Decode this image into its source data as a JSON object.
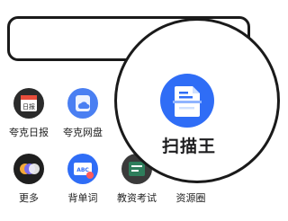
{
  "apps": [
    {
      "label": "夸克日报",
      "icon": "daily-news-icon"
    },
    {
      "label": "夸克网盘",
      "icon": "cloud-drive-icon"
    },
    {
      "label": "更多",
      "icon": "more-apps-icon"
    },
    {
      "label": "背单词",
      "icon": "vocabulary-icon"
    },
    {
      "label": "教资考试",
      "icon": "exam-icon"
    },
    {
      "label": "资源圈",
      "icon": "resource-circle-icon"
    }
  ],
  "daily_icon_text": "日报",
  "vocab_icon_text": "ABC",
  "featured": {
    "label": "扫描王",
    "icon": "scanner-icon"
  },
  "colors": {
    "accent_blue": "#2f6df6",
    "dark": "#1a1a1a"
  }
}
